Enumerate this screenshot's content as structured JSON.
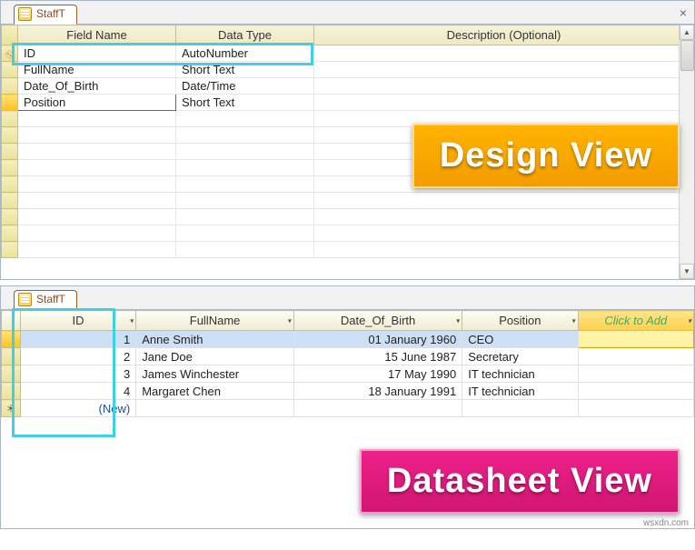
{
  "designView": {
    "tab": "StaffT",
    "columns": {
      "field": "Field Name",
      "type": "Data Type",
      "desc": "Description (Optional)"
    },
    "rows": [
      {
        "field": "ID",
        "type": "AutoNumber",
        "pk": true
      },
      {
        "field": "FullName",
        "type": "Short Text"
      },
      {
        "field": "Date_Of_Birth",
        "type": "Date/Time"
      },
      {
        "field": "Position",
        "type": "Short Text",
        "active": true
      }
    ],
    "callout": "Design View"
  },
  "datasheetView": {
    "tab": "StaffT",
    "columns": {
      "id": "ID",
      "name": "FullName",
      "dob": "Date_Of_Birth",
      "pos": "Position",
      "add": "Click to Add"
    },
    "rows": [
      {
        "id": "1",
        "name": "Anne Smith",
        "dob": "01 January 1960",
        "pos": "CEO",
        "selected": true
      },
      {
        "id": "2",
        "name": "Jane Doe",
        "dob": "15 June 1987",
        "pos": "Secretary"
      },
      {
        "id": "3",
        "name": "James Winchester",
        "dob": "17 May 1990",
        "pos": "IT technician"
      },
      {
        "id": "4",
        "name": "Margaret Chen",
        "dob": "18 January 1991",
        "pos": "IT technician"
      }
    ],
    "newRowLabel": "(New)",
    "callout": "Datasheet View"
  },
  "watermark": "wsxdn.com"
}
